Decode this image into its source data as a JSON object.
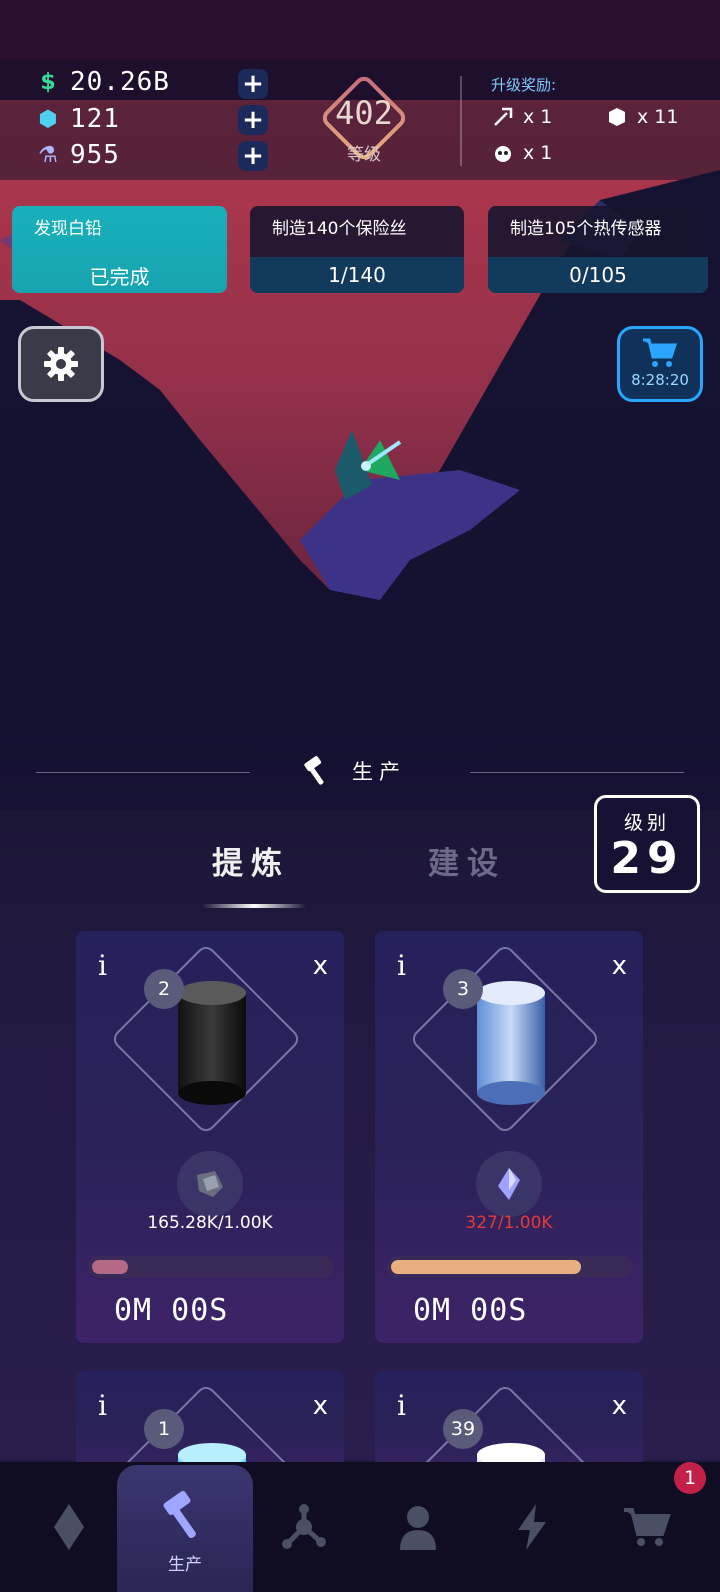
{
  "resources": [
    {
      "icon": "dollar-icon",
      "symbol": "$",
      "value": "20.26B",
      "color": "#35d99a"
    },
    {
      "icon": "gem-icon",
      "symbol": "⬢",
      "value": "121",
      "color": "#4fd0f0"
    },
    {
      "icon": "flask-icon",
      "symbol": "⚗",
      "value": "955",
      "color": "#a9b8ff"
    }
  ],
  "player_level": {
    "value": "402",
    "label": "等级"
  },
  "upgrade_reward": {
    "title": "升级奖励:",
    "items": [
      {
        "icon": "pickaxe-icon",
        "text": "x 1"
      },
      {
        "icon": "gem-icon",
        "text": "x 11"
      },
      {
        "icon": "robot-icon",
        "text": "x 1"
      }
    ]
  },
  "quests": [
    {
      "title": "发现白铅",
      "status": "已完成"
    },
    {
      "title": "制造140个保险丝",
      "status": "1/140"
    },
    {
      "title": "制造105个热传感器",
      "status": "0/105"
    }
  ],
  "shop_timer": "8:28:20",
  "section_title": "生产",
  "tabs": [
    "提炼",
    "建设"
  ],
  "grade": {
    "label": "级别",
    "value": "29"
  },
  "cards": [
    {
      "info": "i",
      "close": "x",
      "count": "2",
      "stock": "165.28K/1.00K",
      "stock_color": "#ffffff",
      "progress": 0.15,
      "bar_color": "#b46a86",
      "time": "0M 00S",
      "cyl": [
        "#111",
        "#3a3a3a",
        "#0a0a0a"
      ],
      "ore_color": "#6a6f80"
    },
    {
      "info": "i",
      "close": "x",
      "count": "3",
      "stock": "327/1.00K",
      "stock_color": "#e63a3a",
      "progress": 0.8,
      "bar_color": "#e8b080",
      "time": "0M 00S",
      "cyl": [
        "#5e8fd8",
        "#c8daf6",
        "#3a5fa8"
      ],
      "ore_color": "#9fa2ff"
    },
    {
      "info": "i",
      "close": "x",
      "count": "1"
    },
    {
      "info": "i",
      "close": "x",
      "count": "39"
    }
  ],
  "nav": [
    {
      "icon": "gem-icon"
    },
    {
      "icon": "hammer-icon",
      "label": "生产"
    },
    {
      "icon": "network-icon"
    },
    {
      "icon": "person-icon"
    },
    {
      "icon": "lightning-icon"
    },
    {
      "icon": "cart-icon",
      "badge": "1"
    }
  ]
}
